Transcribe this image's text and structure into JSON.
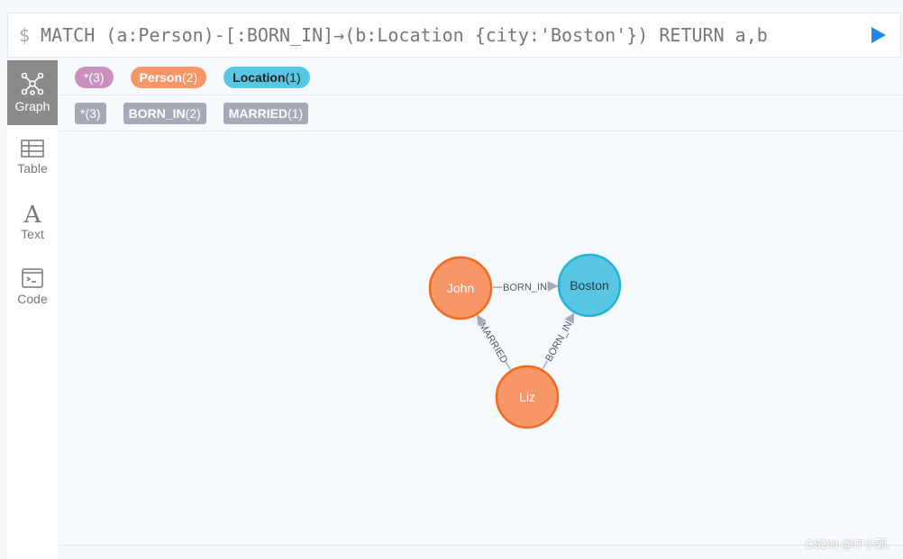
{
  "query": {
    "prompt": "$",
    "text": "MATCH (a:Person)-[:BORN_IN]→(b:Location {city:'Boston'}) RETURN a,b"
  },
  "sidebar": {
    "items": [
      {
        "label": "Graph",
        "icon": "graph-icon",
        "active": true
      },
      {
        "label": "Table",
        "icon": "table-icon"
      },
      {
        "label": "Text",
        "icon": "text-icon"
      },
      {
        "label": "Code",
        "icon": "code-icon"
      }
    ]
  },
  "node_labels": [
    {
      "name": "*",
      "count": "(3)",
      "color": "#c990c0"
    },
    {
      "name": "Person",
      "count": "(2)",
      "color": "#f79767"
    },
    {
      "name": "Location",
      "count": "(1)",
      "color": "#57c7e3"
    }
  ],
  "rel_types": [
    {
      "name": "*",
      "count": "(3)"
    },
    {
      "name": "BORN_IN",
      "count": "(2)"
    },
    {
      "name": "MARRIED",
      "count": "(1)"
    }
  ],
  "graph": {
    "nodes": [
      {
        "id": "john",
        "label": "John",
        "color": "#f79767",
        "stroke": "#f36924"
      },
      {
        "id": "boston",
        "label": "Boston",
        "color": "#57c7e3",
        "stroke": "#23b3d7"
      },
      {
        "id": "liz",
        "label": "Liz",
        "color": "#f79767",
        "stroke": "#f36924"
      }
    ],
    "edges": [
      {
        "from": "john",
        "to": "boston",
        "label": "BORN_IN"
      },
      {
        "from": "liz",
        "to": "john",
        "label": "MARRIED"
      },
      {
        "from": "liz",
        "to": "boston",
        "label": "BORN_IN"
      }
    ]
  },
  "watermark": "CSDN @IT小郭."
}
